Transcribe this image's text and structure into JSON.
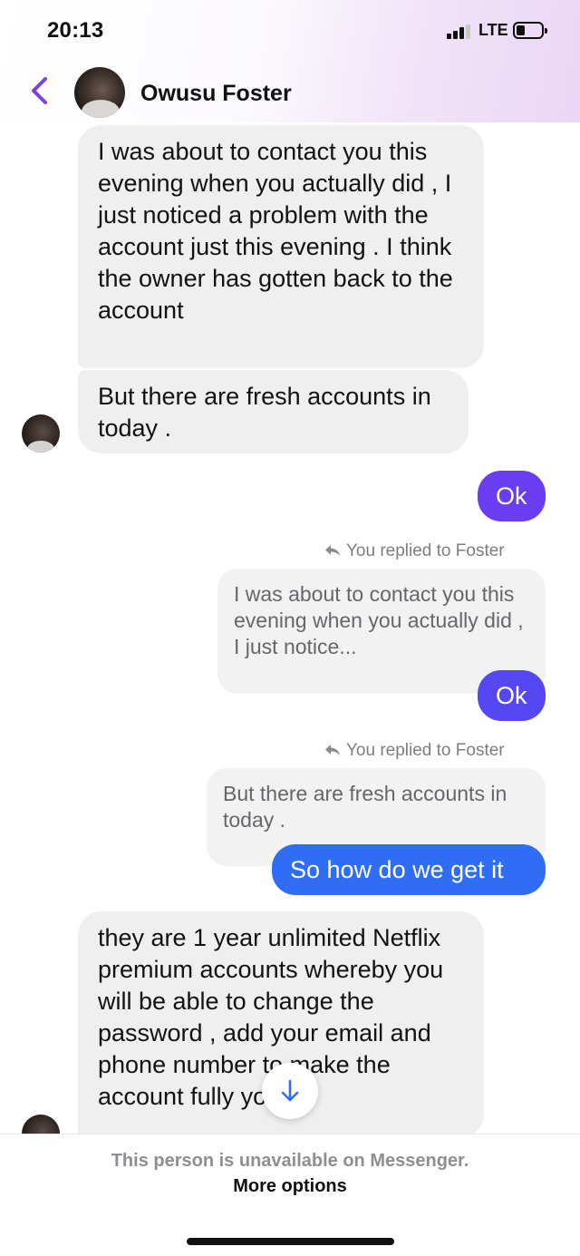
{
  "status_bar": {
    "time": "20:13",
    "network": "LTE"
  },
  "header": {
    "contact_name": "Owusu Foster"
  },
  "messages": {
    "incoming_1": "I was about to contact you this evening when you actually did , I just noticed a problem with the account just this evening . I think the owner has gotten back to the account",
    "incoming_2": "But there are fresh accounts in today .",
    "outgoing_1": "Ok",
    "reply_note_1": "You replied to Foster",
    "quote_1": "I was about to contact you this evening when you actually did , I just notice...",
    "outgoing_2": "Ok",
    "reply_note_2": "You replied to Foster",
    "quote_2": "But there are fresh accounts in today .",
    "outgoing_3": "So how do we get it",
    "incoming_3": "they are 1 year unlimited Netflix premium accounts whereby you will be able to change the password , add your email and phone number to make the account fully yours"
  },
  "footer": {
    "unavailable_text": "This person is unavailable on Messenger.",
    "more_options": "More options"
  },
  "colors": {
    "accent_purple": "#7b3fe4",
    "outgoing_violet": "#6a3cf2",
    "outgoing_blue": "#2f6df5",
    "incoming_bubble": "#efeff0"
  },
  "icons": [
    "chevron-left-icon",
    "reply-arrow-icon",
    "arrow-down-icon",
    "signal-icon",
    "battery-icon"
  ]
}
